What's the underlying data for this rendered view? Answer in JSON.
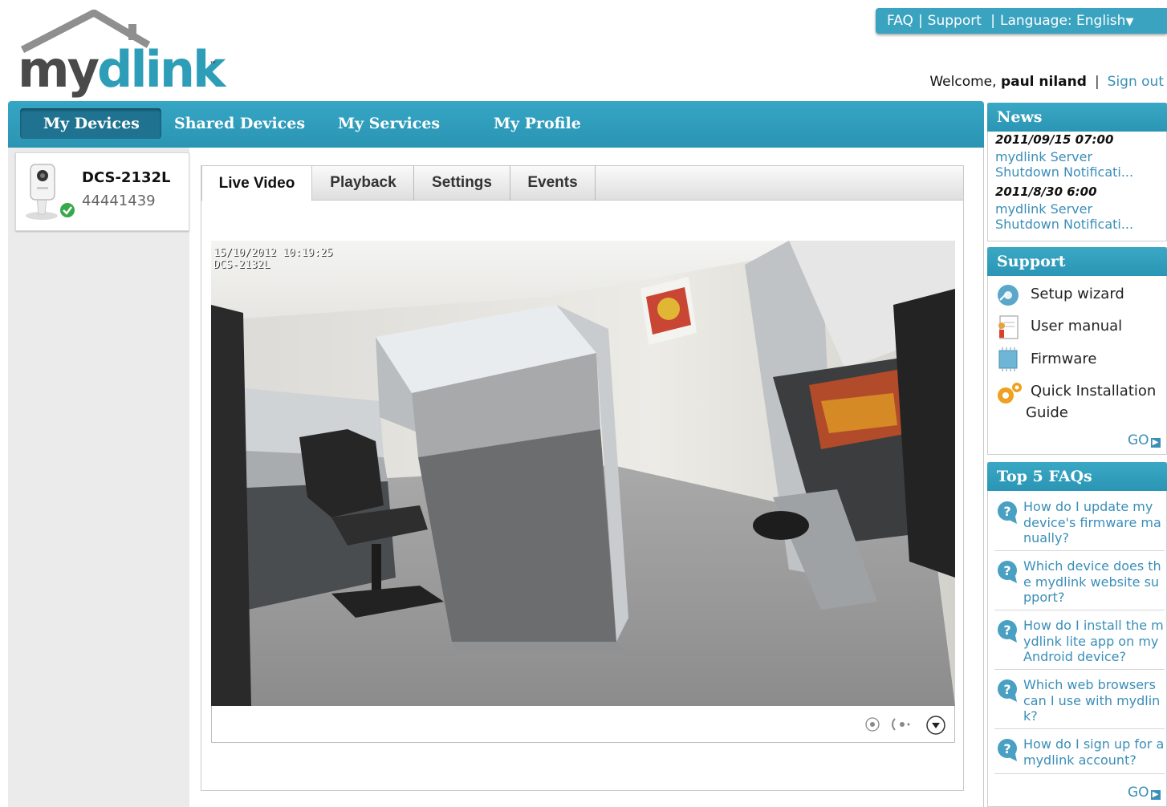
{
  "header": {
    "logo_my": "my",
    "logo_dlink": "dlink",
    "logo_tm": "™",
    "faq_link": "FAQ",
    "support_link": "Support",
    "language_label": "Language: English",
    "welcome_prefix": "Welcome,",
    "username": "paul niland",
    "signout_link": "Sign out"
  },
  "nav": {
    "tabs": [
      {
        "label": "My Devices",
        "active": true
      },
      {
        "label": "Shared Devices"
      },
      {
        "label": "My Services"
      },
      {
        "label": "My Profile"
      }
    ]
  },
  "device": {
    "name": "DCS-2132L",
    "id": "44441439",
    "status": "online"
  },
  "device_tabs": [
    {
      "label": "Live Video",
      "active": true
    },
    {
      "label": "Playback"
    },
    {
      "label": "Settings"
    },
    {
      "label": "Events"
    }
  ],
  "video": {
    "timestamp": "15/10/2012 10:19:25",
    "camera_label": "DCS-2132L"
  },
  "news": {
    "title": "News",
    "items": [
      {
        "date": "2011/09/15 07:00",
        "line1": "mydlink Server",
        "line2": "Shutdown Notificati..."
      },
      {
        "date": "2011/8/30 6:00",
        "line1": "mydlink Server",
        "line2": "Shutdown Notificati..."
      }
    ]
  },
  "support": {
    "title": "Support",
    "items": [
      "Setup wizard",
      "User manual",
      "Firmware",
      "Quick Installation"
    ],
    "item4_line2": "Guide",
    "go": "GO"
  },
  "faqs": {
    "title": "Top 5 FAQs",
    "items": [
      "How do I update my device's firmware manually?",
      "Which device does the mydlink website support?",
      "How do I install the mydlink lite app on my Android device?",
      "Which web browsers can I use with mydlink?",
      "How do I sign up for a mydlink account?"
    ],
    "go": "GO"
  },
  "colors": {
    "brand_blue": "#2d9db8",
    "link_blue": "#3a8eb8",
    "nav_active": "#1f7391"
  }
}
